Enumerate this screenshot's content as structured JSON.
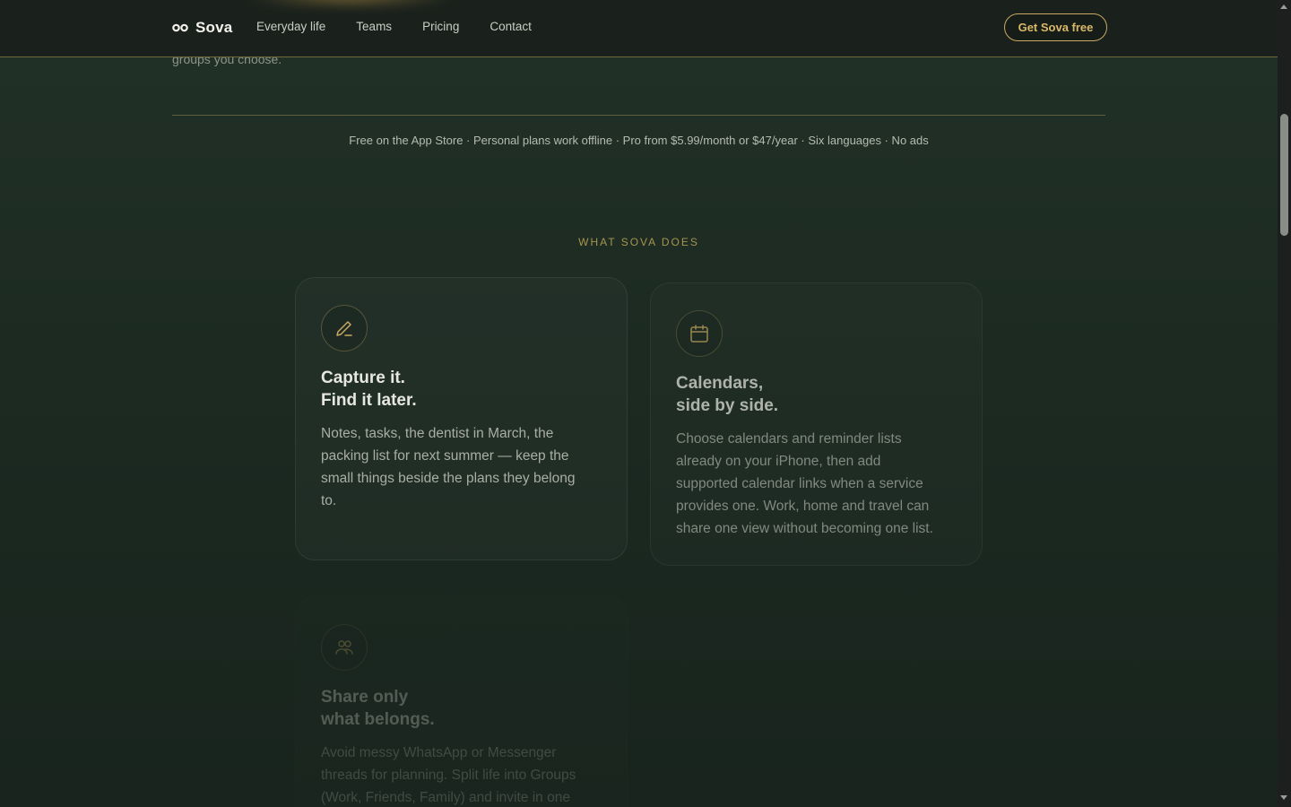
{
  "header": {
    "brand": "Sova",
    "nav": [
      "Everyday life",
      "Teams",
      "Pricing",
      "Contact"
    ],
    "cta": "Get Sova free"
  },
  "hero": {
    "partial_text": "groups you choose.",
    "facts": "Free on the App Store · Personal plans work offline · Pro from $5.99/month or $47/year · Six languages · No ads"
  },
  "features": {
    "eyebrow": "WHAT SOVA DOES",
    "cards": [
      {
        "icon": "pencil-icon",
        "title_1": "Capture it.",
        "title_2": "Find it later.",
        "body": "Notes, tasks, the dentist in March, the packing list for next summer — keep the small things beside the plans they belong to."
      },
      {
        "icon": "calendar-icon",
        "title_1": "Calendars,",
        "title_2": "side by side.",
        "body": "Choose calendars and reminder lists already on your iPhone, then add supported calendar links when a service provides one. Work, home and travel can share one view without becoming one list."
      },
      {
        "icon": "people-icon",
        "title_1": "Share only",
        "title_2": "what belongs.",
        "body": "Avoid messy WhatsApp or Messenger threads for planning. Split life into Groups (Work, Friends, Family) and invite in one"
      }
    ]
  },
  "colors": {
    "accent_gold": "#c9a961",
    "background": "#1c2a22",
    "header_bg": "#1a211c"
  }
}
